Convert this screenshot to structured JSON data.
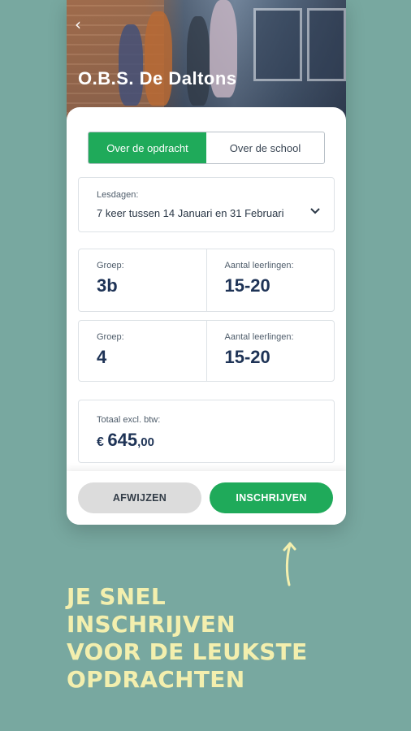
{
  "header": {
    "back_icon": "chevron-left-icon",
    "school_name": "O.B.S. De Daltons"
  },
  "tabs": [
    {
      "label": "Over de opdracht",
      "active": true
    },
    {
      "label": "Over de school",
      "active": false
    }
  ],
  "lesson_days": {
    "label": "Lesdagen:",
    "value": "7 keer tussen 14 Januari en 31 Februari",
    "icon": "chevron-down-icon"
  },
  "groups": [
    {
      "group_label": "Groep:",
      "group_value": "3b",
      "count_label": "Aantal leerlingen:",
      "count_value": "15-20"
    },
    {
      "group_label": "Groep:",
      "group_value": "4",
      "count_label": "Aantal leerlingen:",
      "count_value": "15-20"
    }
  ],
  "total": {
    "label": "Totaal excl. btw:",
    "currency": "€",
    "amount": "645",
    "cents": ",00"
  },
  "actions": {
    "decline_label": "AFWIJZEN",
    "enroll_label": "INSCHRIJVEN"
  },
  "tagline_lines": [
    "JE SNEL",
    "INSCHRIJVEN",
    "VOOR DE LEUKSTE",
    "OPDRACHTEN"
  ],
  "colors": {
    "background": "#78a8a0",
    "accent_green": "#1faa5a",
    "navy": "#1e3356",
    "tagline": "#f3efae"
  }
}
